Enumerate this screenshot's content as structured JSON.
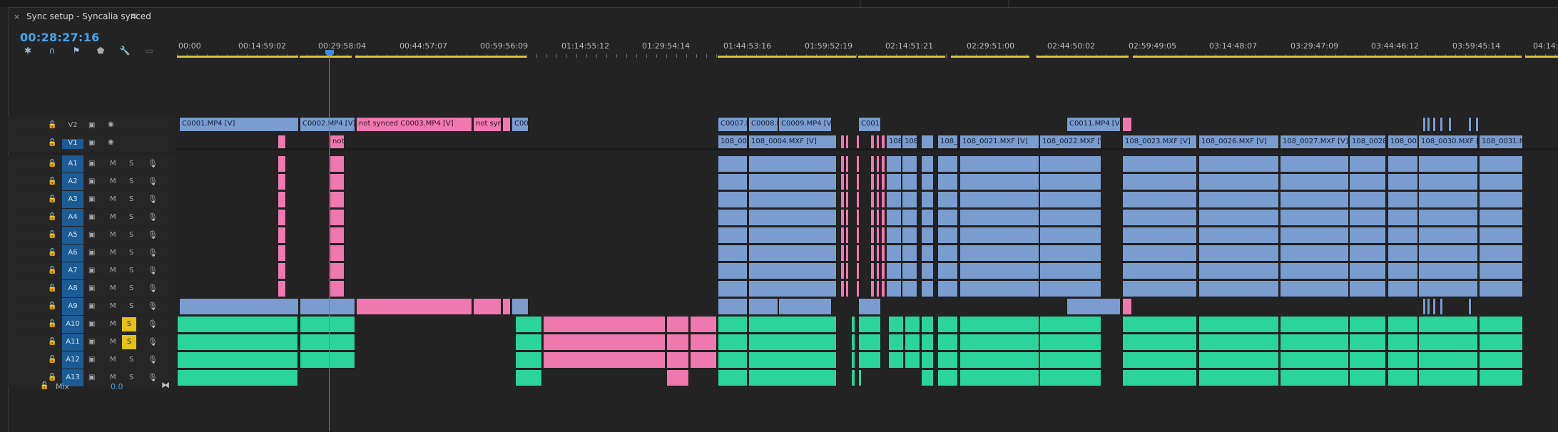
{
  "sequence": {
    "close_glyph": "×",
    "title": "Sync setup - Syncalia synced",
    "menu_glyph": "≡",
    "timecode": "00:28:27:16"
  },
  "toolbar": {
    "icons": [
      "snap-icon",
      "linked-selection-icon",
      "add-marker-icon",
      "marker-icon",
      "wrench-icon",
      "captions-icon"
    ]
  },
  "ruler": {
    "labels": [
      "00:00",
      "00:14:59:02",
      "00:29:58:04",
      "00:44:57:07",
      "00:59:56:09",
      "01:14:55:12",
      "01:29:54:14",
      "01:44:53:16",
      "01:59:52:19",
      "02:14:51:21",
      "02:29:51:00",
      "02:44:50:02",
      "02:59:49:05",
      "03:14:48:07",
      "03:29:47:09",
      "03:44:46:12",
      "03:59:45:14",
      "04:14:4"
    ]
  },
  "tracks": {
    "video": [
      {
        "name": "V2"
      },
      {
        "name": "V1"
      }
    ],
    "audio": [
      {
        "name": "A1",
        "mute": "M",
        "solo": "S",
        "solo_on": false
      },
      {
        "name": "A2",
        "mute": "M",
        "solo": "S",
        "solo_on": false
      },
      {
        "name": "A3",
        "mute": "M",
        "solo": "S",
        "solo_on": false
      },
      {
        "name": "A4",
        "mute": "M",
        "solo": "S",
        "solo_on": false
      },
      {
        "name": "A5",
        "mute": "M",
        "solo": "S",
        "solo_on": false
      },
      {
        "name": "A6",
        "mute": "M",
        "solo": "S",
        "solo_on": false
      },
      {
        "name": "A7",
        "mute": "M",
        "solo": "S",
        "solo_on": false
      },
      {
        "name": "A8",
        "mute": "M",
        "solo": "S",
        "solo_on": false
      },
      {
        "name": "A9",
        "mute": "M",
        "solo": "S",
        "solo_on": false
      },
      {
        "name": "A10",
        "mute": "M",
        "solo": "S",
        "solo_on": true
      },
      {
        "name": "A11",
        "mute": "M",
        "solo": "S",
        "solo_on": true
      },
      {
        "name": "A12",
        "mute": "M",
        "solo": "S",
        "solo_on": false
      },
      {
        "name": "A13",
        "mute": "M",
        "solo": "S",
        "solo_on": false
      }
    ],
    "mix": {
      "label": "Mix",
      "value": "0.0"
    }
  },
  "clips": {
    "v2": [
      "C0001.MP4 [V]",
      "C0002.MP4 [V]",
      "not synced C0003.MP4 [V]",
      "not sync",
      "C00",
      "C0007.M",
      "C0008.M",
      "C0009.MP4 [V]",
      "C0010",
      "C0011.MP4 [V]"
    ],
    "v1": [
      "not",
      "108_000",
      "108_0004.MXF [V]",
      "108",
      "108",
      "108_",
      "108_0021.MXF [V]",
      "108_0022.MXF [V]",
      "108_0023.MXF [V]",
      "108_0026.MXF [V]",
      "108_0027.MXF [V]",
      "108_0028.",
      "108_002",
      "108_0030.MXF [V]",
      "108_0031.M"
    ]
  },
  "colors": {
    "playhead": "#3f8fe0",
    "clip_blue": "#7b9ccf",
    "clip_pink": "#ef79ae",
    "clip_green": "#2bd49a",
    "solo_on": "#e4c11a",
    "selected_track": "#1c5b94"
  }
}
